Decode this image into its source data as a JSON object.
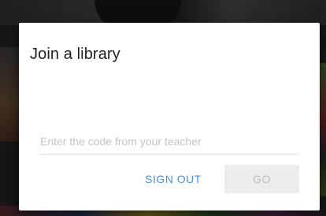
{
  "dialog": {
    "title": "Join a library",
    "code_input": {
      "value": "",
      "placeholder": "Enter the code from your teacher"
    },
    "buttons": {
      "sign_out_label": "SIGN OUT",
      "go_label": "GO"
    }
  },
  "colors": {
    "accent": "#4a90d9",
    "disabled_button_bg": "#ececec",
    "disabled_button_text": "#bdbdbd"
  }
}
